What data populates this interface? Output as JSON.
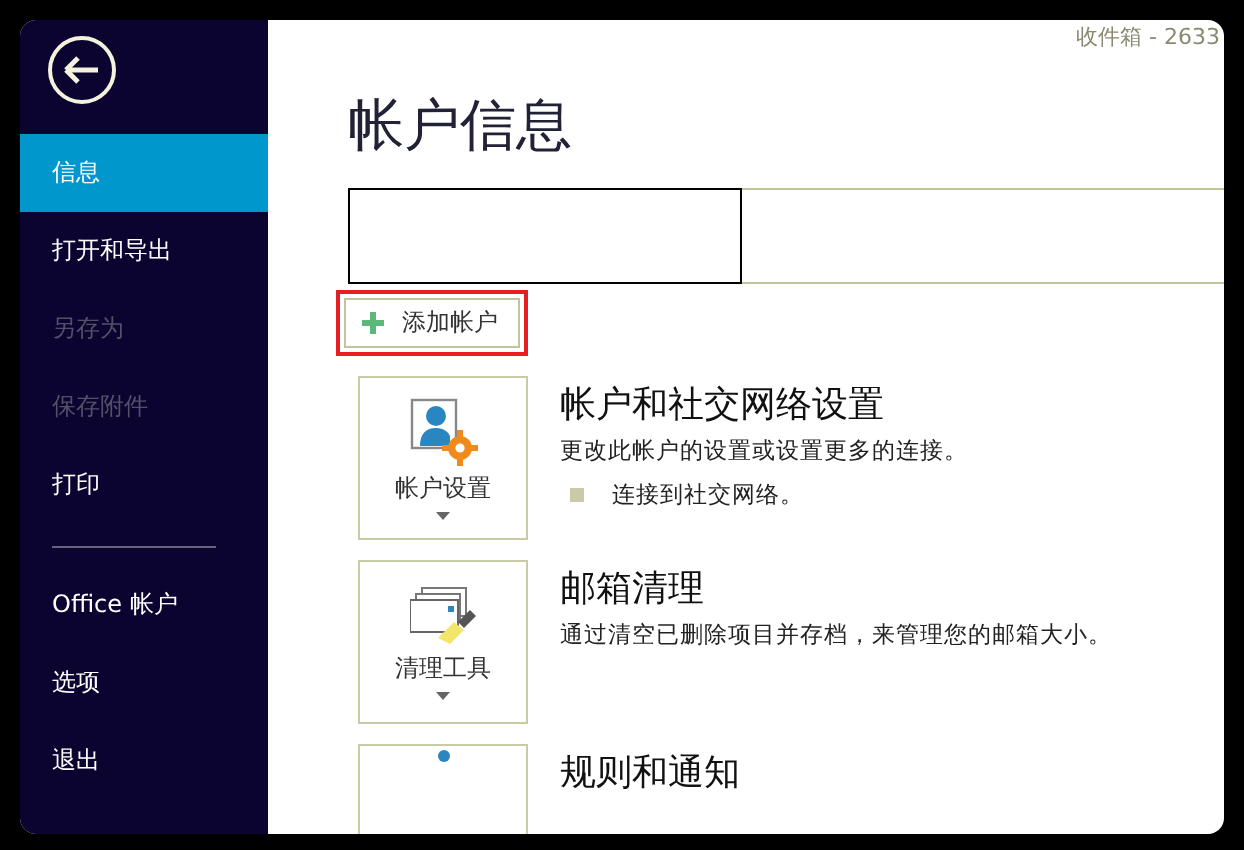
{
  "window": {
    "title": "收件箱 - 2633"
  },
  "sidebar": {
    "items": [
      {
        "label": "信息",
        "selected": true,
        "disabled": false,
        "divider_before": false
      },
      {
        "label": "打开和导出",
        "selected": false,
        "disabled": false,
        "divider_before": false
      },
      {
        "label": "另存为",
        "selected": false,
        "disabled": true,
        "divider_before": false
      },
      {
        "label": "保存附件",
        "selected": false,
        "disabled": true,
        "divider_before": false
      },
      {
        "label": "打印",
        "selected": false,
        "disabled": false,
        "divider_before": false
      },
      {
        "label": "Office 帐户",
        "selected": false,
        "disabled": false,
        "divider_before": true
      },
      {
        "label": "选项",
        "selected": false,
        "disabled": false,
        "divider_before": false
      },
      {
        "label": "退出",
        "selected": false,
        "disabled": false,
        "divider_before": false
      }
    ]
  },
  "page_title": "帐户信息",
  "add_account_button": {
    "label": "添加帐户",
    "highlighted": true
  },
  "sections": [
    {
      "kind": "account",
      "button_label": "帐户设置",
      "title": "帐户和社交网络设置",
      "description": "更改此帐户的设置或设置更多的连接。",
      "bullets": [
        "连接到社交网络。"
      ]
    },
    {
      "kind": "cleanup",
      "button_label": "清理工具",
      "title": "邮箱清理",
      "description": "通过清空已删除项目并存档，来管理您的邮箱大小。"
    },
    {
      "kind": "rules",
      "title": "规则和通知"
    }
  ]
}
